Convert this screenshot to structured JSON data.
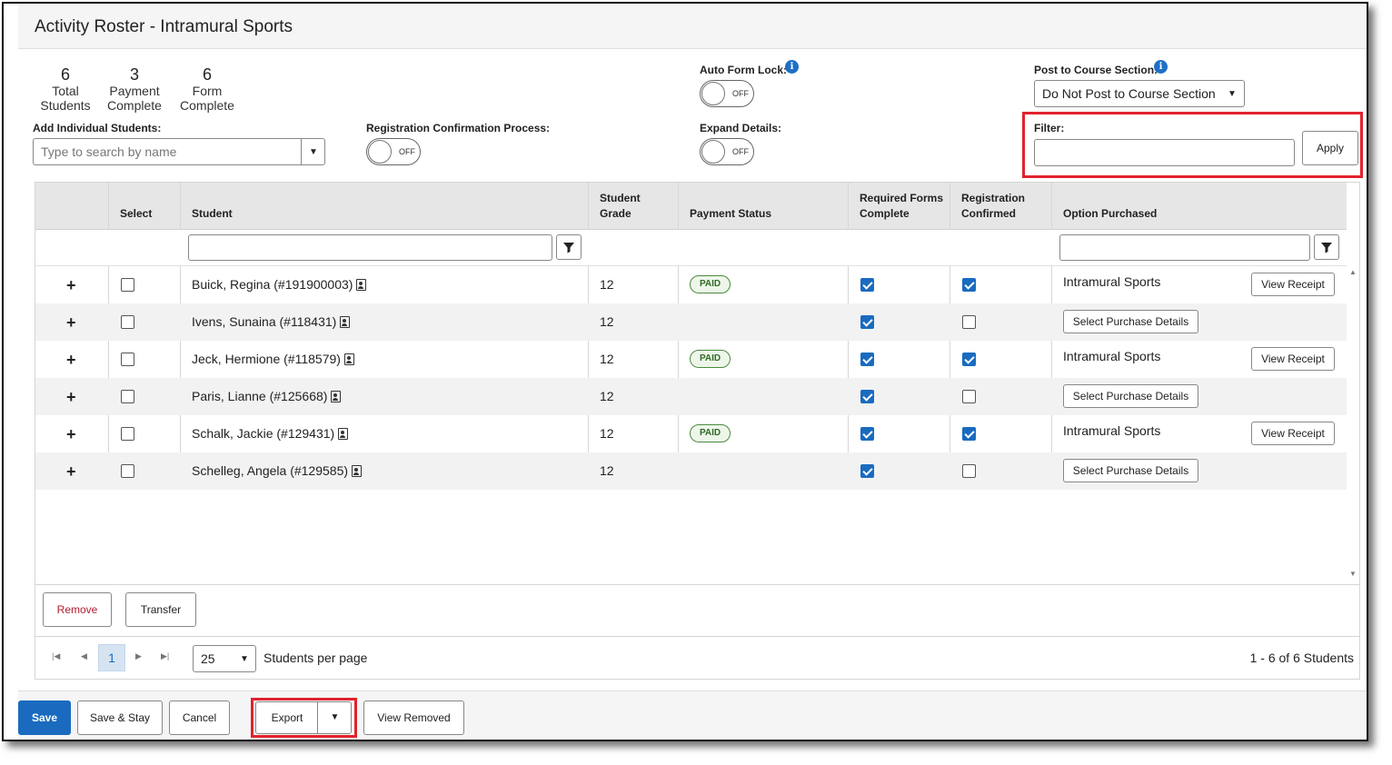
{
  "title": "Activity Roster - Intramural Sports",
  "stats": [
    {
      "value": "6",
      "line1": "Total",
      "line2": "Students"
    },
    {
      "value": "3",
      "line1": "Payment",
      "line2": "Complete"
    },
    {
      "value": "6",
      "line1": "Form",
      "line2": "Complete"
    }
  ],
  "auto_form_lock": {
    "label": "Auto Form Lock:",
    "state": "OFF"
  },
  "post_to_course": {
    "label": "Post to Course Section:",
    "value": "Do Not Post to Course Section"
  },
  "add_students": {
    "label": "Add Individual Students:",
    "placeholder": "Type to search by name"
  },
  "registration_confirmation": {
    "label": "Registration Confirmation Process:",
    "state": "OFF"
  },
  "expand_details": {
    "label": "Expand Details:",
    "state": "OFF"
  },
  "filter": {
    "label": "Filter:",
    "value": "",
    "apply_label": "Apply"
  },
  "grid": {
    "headers": {
      "select": "Select",
      "student": "Student",
      "grade_1": "Student",
      "grade_2": "Grade",
      "payment": "Payment Status",
      "forms_1": "Required Forms",
      "forms_2": "Complete",
      "confirmed_1": "Registration",
      "confirmed_2": "Confirmed",
      "option": "Option Purchased"
    },
    "rows": [
      {
        "expand": "+",
        "student": "Buick, Regina (#191900003)",
        "grade": "12",
        "payment": "PAID",
        "forms": true,
        "confirmed": true,
        "option": "Intramural Sports",
        "action": "View Receipt"
      },
      {
        "expand": "+",
        "student": "Ivens, Sunaina (#118431)",
        "grade": "12",
        "payment": "",
        "forms": true,
        "confirmed": false,
        "option": "",
        "action": "Select Purchase Details"
      },
      {
        "expand": "+",
        "student": "Jeck, Hermione (#118579)",
        "grade": "12",
        "payment": "PAID",
        "forms": true,
        "confirmed": true,
        "option": "Intramural Sports",
        "action": "View Receipt"
      },
      {
        "expand": "+",
        "student": "Paris, Lianne (#125668)",
        "grade": "12",
        "payment": "",
        "forms": true,
        "confirmed": false,
        "option": "",
        "action": "Select Purchase Details"
      },
      {
        "expand": "+",
        "student": "Schalk, Jackie (#129431)",
        "grade": "12",
        "payment": "PAID",
        "forms": true,
        "confirmed": true,
        "option": "Intramural Sports",
        "action": "View Receipt"
      },
      {
        "expand": "+",
        "student": "Schelleg, Angela (#129585)",
        "grade": "12",
        "payment": "",
        "forms": true,
        "confirmed": false,
        "option": "",
        "action": "Select Purchase Details"
      }
    ]
  },
  "grid_actions": {
    "remove": "Remove",
    "transfer": "Transfer"
  },
  "pager": {
    "page": "1",
    "per_page": "25",
    "per_page_label": "Students per page",
    "summary": "1 - 6 of 6 Students"
  },
  "footer": {
    "save": "Save",
    "save_stay": "Save & Stay",
    "cancel": "Cancel",
    "export": "Export",
    "view_removed": "View Removed"
  },
  "colors": {
    "primary": "#1a6bbf",
    "highlight": "#e2222d",
    "paid_badge": "#2f6b24"
  }
}
